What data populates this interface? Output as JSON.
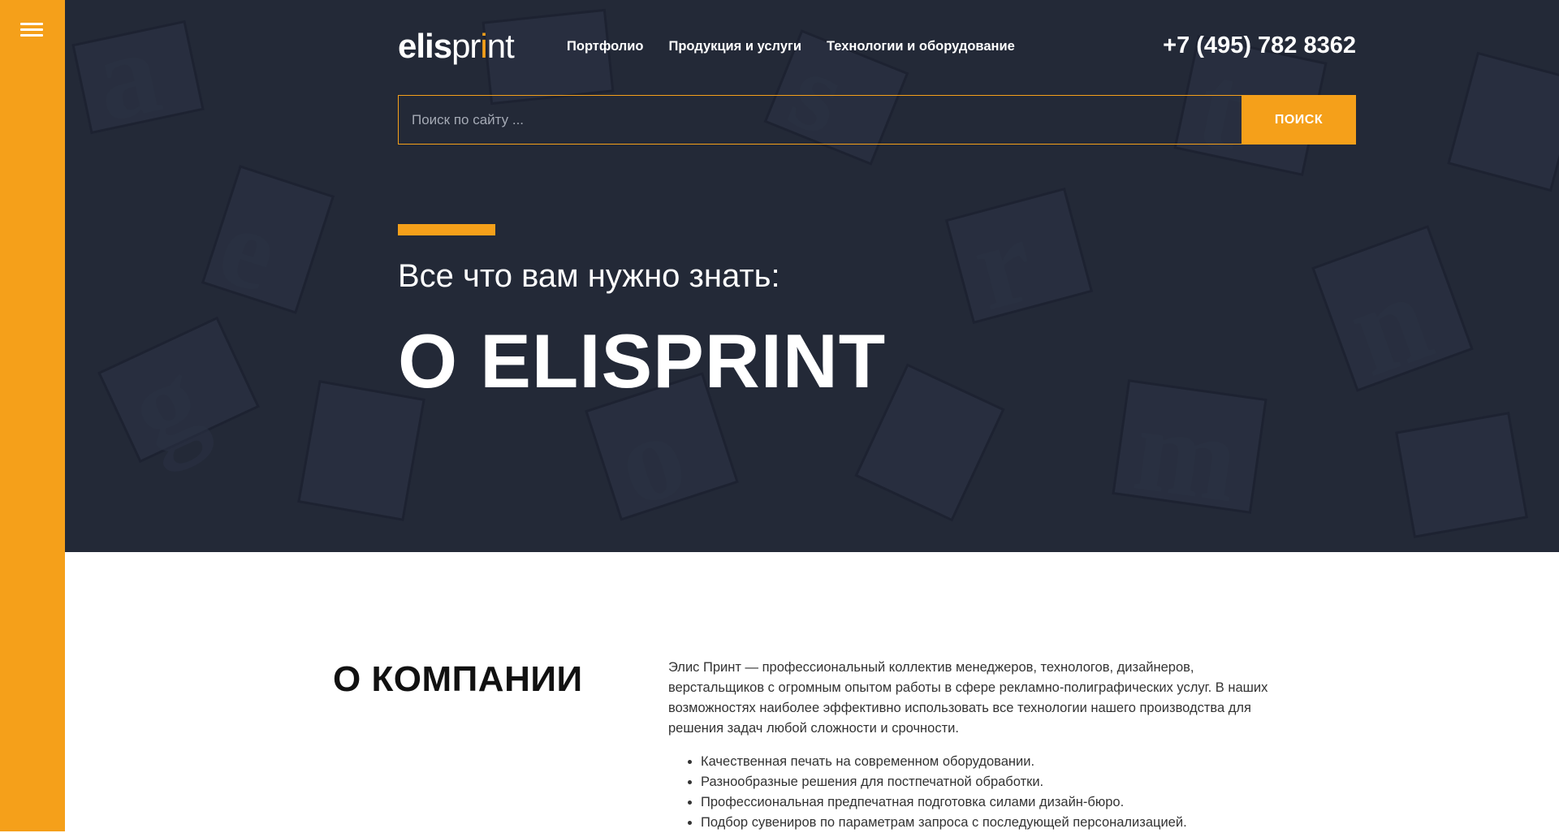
{
  "logo": {
    "part1": "elis",
    "part2": "pr",
    "part3": "i",
    "part4": "nt"
  },
  "nav": [
    {
      "label": "Портфолио"
    },
    {
      "label": "Продукция и услуги"
    },
    {
      "label": "Технологии и оборудование"
    }
  ],
  "phone": "+7 (495) 782 8362",
  "search": {
    "placeholder": "Поиск по сайту ...",
    "button": "ПОИСК"
  },
  "hero": {
    "subtitle": "Все что вам нужно знать:",
    "title": "О ELISPRINT"
  },
  "about": {
    "title": "О КОМПАНИИ",
    "text": "Элис Принт — профессиональный коллектив менеджеров, технологов, дизайнеров, верстальщиков с огромным опытом работы в сфере рекламно-полиграфических услуг. В наших возможностях наиболее эффективно использовать все технологии нашего производства для решения задач любой сложности и срочности.",
    "bullets": [
      "Качественная печать на современном оборудовании.",
      "Разнообразные решения для постпечатной обработки.",
      "Профессиональная предпечатная подготовка силами дизайн-бюро.",
      "Подбор сувениров по параметрам запроса с последующей персонализацией."
    ]
  },
  "colors": {
    "accent": "#f5a01a",
    "hero_bg": "#252b3a"
  },
  "icons": {
    "menu": "hamburger-icon"
  }
}
